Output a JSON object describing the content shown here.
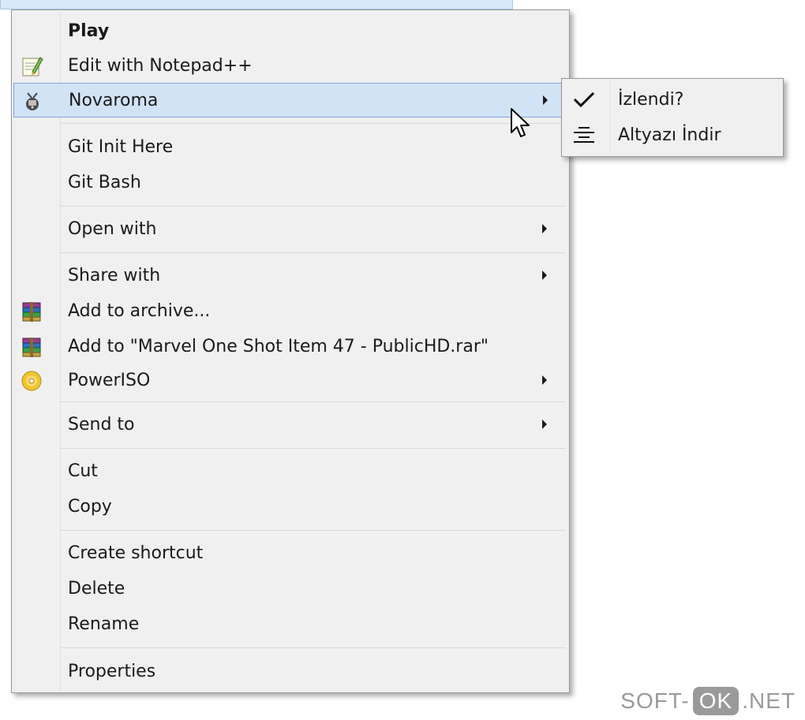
{
  "context_menu": {
    "items": [
      {
        "label": "Play",
        "bold": true
      },
      {
        "label": "Edit with Notepad++",
        "icon": "notepadpp-icon"
      },
      {
        "label": "Novaroma",
        "icon": "novaroma-icon",
        "submenu": true,
        "highlighted": true
      },
      {
        "label": "Git Init Here"
      },
      {
        "label": "Git Bash"
      },
      {
        "label": "Open with",
        "submenu": true
      },
      {
        "label": "Share with",
        "submenu": true
      },
      {
        "label": "Add to archive...",
        "icon": "winrar-icon"
      },
      {
        "label": "Add to \"Marvel One Shot Item 47 - PublicHD.rar\"",
        "icon": "winrar-icon"
      },
      {
        "label": "PowerISO",
        "icon": "poweriso-icon",
        "submenu": true
      },
      {
        "label": "Send to",
        "submenu": true
      },
      {
        "label": "Cut"
      },
      {
        "label": "Copy"
      },
      {
        "label": "Create shortcut"
      },
      {
        "label": "Delete"
      },
      {
        "label": "Rename"
      },
      {
        "label": "Properties"
      }
    ]
  },
  "submenu": {
    "items": [
      {
        "label": "İzlendi?",
        "icon": "checkmark-icon"
      },
      {
        "label": "Altyazı İndir",
        "icon": "align-center-icon"
      }
    ]
  },
  "watermark": {
    "left": "SOFT-",
    "ok": "OK",
    "right": ".NET"
  },
  "colors": {
    "menu_background": "#f0f0f0",
    "highlight": "#d1e3f7",
    "highlight_border": "#7ea7d8"
  }
}
